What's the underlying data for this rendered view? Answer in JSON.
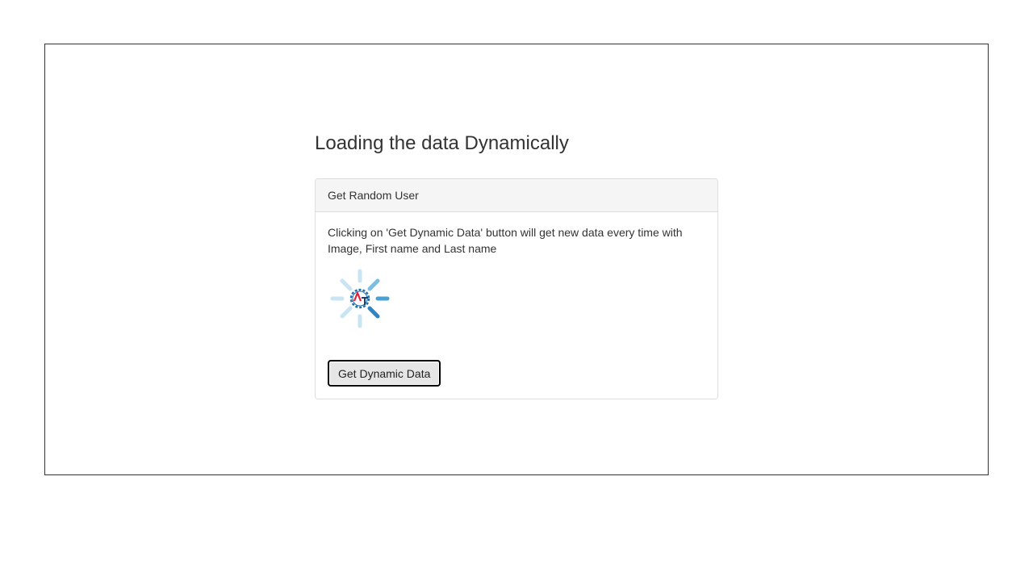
{
  "page": {
    "title": "Loading the data Dynamically"
  },
  "panel": {
    "heading": "Get Random User",
    "description": "Clicking on 'Get Dynamic Data' button will get new data every time with Image, First name and Last name",
    "loader_icon": "loading-spinner-icon",
    "button_label": "Get Dynamic Data"
  },
  "colors": {
    "spinner_light": "#c9e4f2",
    "spinner_mid": "#7fbde0",
    "spinner_dark": "#2f86c6",
    "logo_red": "#e0203a",
    "logo_dark": "#1f3f6b"
  }
}
